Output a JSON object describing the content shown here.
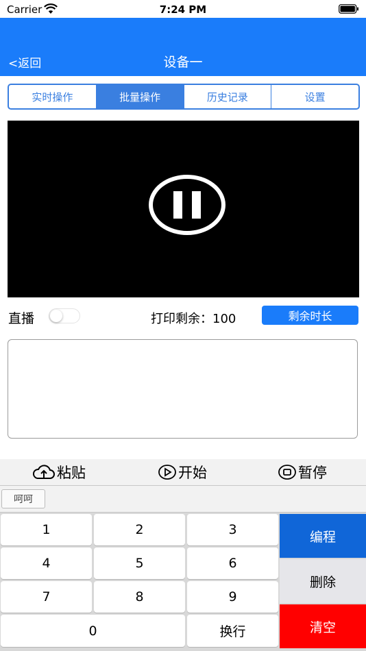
{
  "status_bar": {
    "carrier": "Carrier",
    "time": "7:24 PM"
  },
  "nav": {
    "back": "<返回",
    "title": "设备一"
  },
  "segments": [
    {
      "label": "实时操作",
      "active": false
    },
    {
      "label": "批量操作",
      "active": true
    },
    {
      "label": "历史记录",
      "active": false
    },
    {
      "label": "设置",
      "active": false
    }
  ],
  "live": {
    "label": "直播",
    "on": false
  },
  "print_remaining": {
    "label": "打印剩余：",
    "value": "100",
    "button": "剩余时长"
  },
  "text_input": {
    "value": ""
  },
  "actions": {
    "paste": "粘贴",
    "start": "开始",
    "pause": "暂停"
  },
  "suggestions": [
    "呵呵"
  ],
  "keyboard": {
    "keys": [
      "1",
      "2",
      "3",
      "4",
      "5",
      "6",
      "7",
      "8",
      "9",
      "0"
    ],
    "newline": "换行",
    "program": "编程",
    "delete": "删除",
    "clear": "清空"
  },
  "colors": {
    "accent": "#1a7cfa",
    "segment": "#3a7fe0",
    "program": "#1066d8",
    "clear": "#ff0000"
  }
}
